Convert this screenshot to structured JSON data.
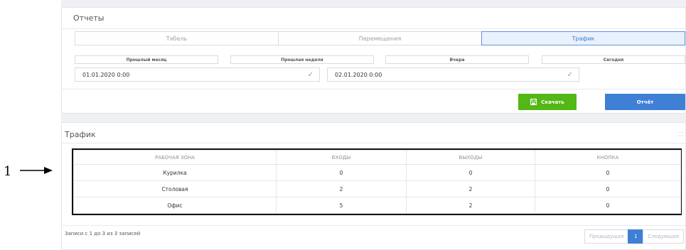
{
  "annotation": {
    "label": "1"
  },
  "reports": {
    "title": "Отчеты",
    "tabs": [
      {
        "label": "Табель",
        "active": false
      },
      {
        "label": "Перемещения",
        "active": false
      },
      {
        "label": "Трафик",
        "active": true
      }
    ],
    "quick_ranges": [
      "Прошлый месяц",
      "Прошлая неделя",
      "Вчера",
      "Сегодня"
    ],
    "date_from": "01.01.2020 0:00",
    "date_to": "02.01.2020 0:00",
    "download_label": "Скачать",
    "report_label": "Отчёт"
  },
  "traffic": {
    "title": "Трафик",
    "columns": [
      "РАБОЧАЯ ЗОНА",
      "ВХОДЫ",
      "ВЫХОДЫ",
      "КНОПКА"
    ],
    "rows": [
      [
        "Курилка",
        "0",
        "0",
        "0"
      ],
      [
        "Столовая",
        "2",
        "2",
        "0"
      ],
      [
        "Офис",
        "5",
        "2",
        "0"
      ]
    ],
    "records_info": "Записи с 1 до 3 из 3 записей",
    "pagination": {
      "prev": "Предыдущая",
      "current": "1",
      "next": "Следующая"
    }
  },
  "colors": {
    "accent_blue": "#3f7fd6",
    "accent_green": "#53b716",
    "check_green": "#7cc04a"
  }
}
